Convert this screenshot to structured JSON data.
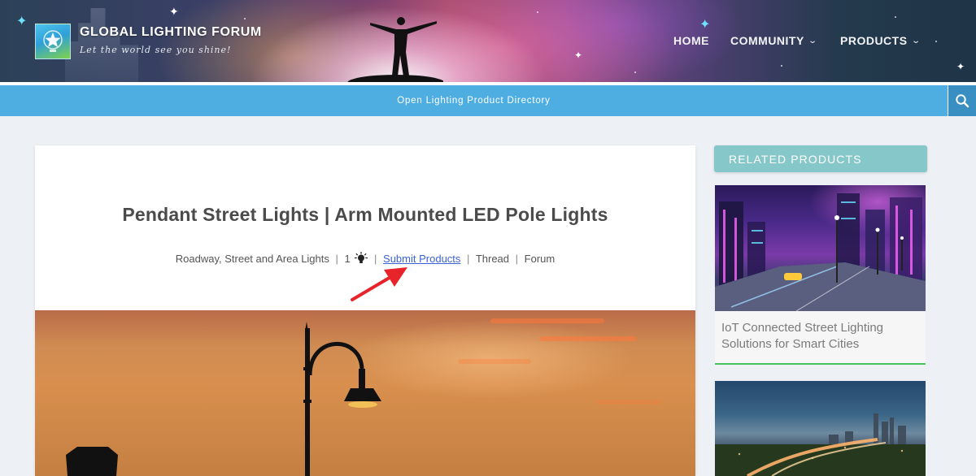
{
  "site": {
    "title": "GLOBAL LIGHTING FORUM",
    "tagline": "Let the world see you shine!"
  },
  "nav": {
    "home": "HOME",
    "community": "COMMUNITY",
    "products": "PRODUCTS"
  },
  "subbar": {
    "link": "Open Lighting Product Directory"
  },
  "icons": {
    "search": "search-icon",
    "logo": "star-logo-icon",
    "chevron": "chevron-down-icon",
    "bulb": "lightbulb-icon",
    "annotation": "red-arrow-icon"
  },
  "article": {
    "title": "Pendant Street Lights | Arm Mounted LED Pole Lights",
    "category": "Roadway, Street and Area Lights",
    "count": "1",
    "submit": "Submit Products",
    "thread": "Thread",
    "forum": "Forum",
    "separator": "|"
  },
  "sidebar": {
    "heading": "RELATED PRODUCTS",
    "products": [
      {
        "caption": "IoT Connected Street Lighting Solutions for Smart Cities"
      },
      {
        "caption": ""
      }
    ]
  },
  "colors": {
    "subbar": "#4eaee1",
    "search_button": "#3a8fc2",
    "side_heading": "#86c7c9",
    "link": "#3a63d6",
    "accent_line": "#46c35a",
    "annotation_arrow": "#e8242b"
  }
}
